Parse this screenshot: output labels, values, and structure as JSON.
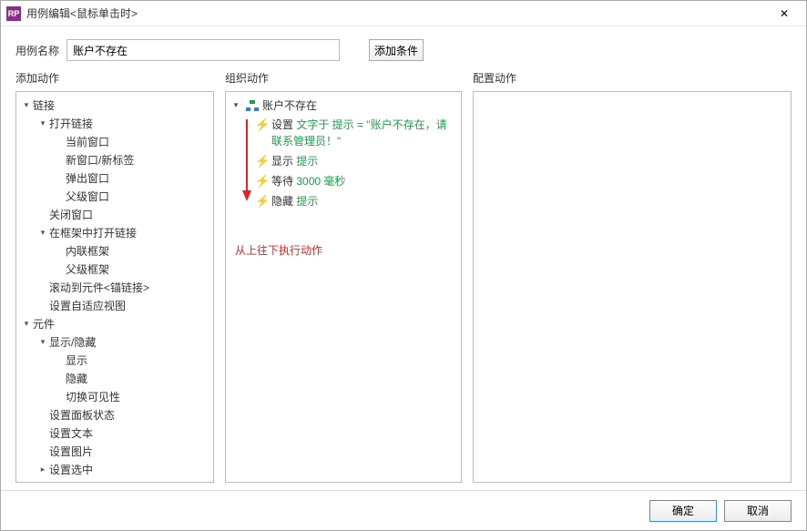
{
  "window": {
    "app_icon_text": "RP",
    "title": "用例编辑<鼠标单击时>"
  },
  "name_row": {
    "label": "用例名称",
    "value": "账户不存在",
    "add_condition": "添加条件"
  },
  "columns": {
    "left_header": "添加动作",
    "mid_header": "组织动作",
    "right_header": "配置动作"
  },
  "left_tree": [
    {
      "level": 0,
      "arrow": "down",
      "label": "链接"
    },
    {
      "level": 1,
      "arrow": "down",
      "label": "打开链接"
    },
    {
      "level": 2,
      "arrow": "none",
      "label": "当前窗口"
    },
    {
      "level": 2,
      "arrow": "none",
      "label": "新窗口/新标签"
    },
    {
      "level": 2,
      "arrow": "none",
      "label": "弹出窗口"
    },
    {
      "level": 2,
      "arrow": "none",
      "label": "父级窗口"
    },
    {
      "level": 1,
      "arrow": "none",
      "label": "关闭窗口"
    },
    {
      "level": 1,
      "arrow": "down",
      "label": "在框架中打开链接"
    },
    {
      "level": 2,
      "arrow": "none",
      "label": "内联框架"
    },
    {
      "level": 2,
      "arrow": "none",
      "label": "父级框架"
    },
    {
      "level": 1,
      "arrow": "none",
      "label": "滚动到元件<锚链接>"
    },
    {
      "level": 1,
      "arrow": "none",
      "label": "设置自适应视图"
    },
    {
      "level": 0,
      "arrow": "down",
      "label": "元件"
    },
    {
      "level": 1,
      "arrow": "down",
      "label": "显示/隐藏"
    },
    {
      "level": 2,
      "arrow": "none",
      "label": "显示"
    },
    {
      "level": 2,
      "arrow": "none",
      "label": "隐藏"
    },
    {
      "level": 2,
      "arrow": "none",
      "label": "切换可见性"
    },
    {
      "level": 1,
      "arrow": "none",
      "label": "设置面板状态"
    },
    {
      "level": 1,
      "arrow": "none",
      "label": "设置文本"
    },
    {
      "level": 1,
      "arrow": "none",
      "label": "设置图片"
    },
    {
      "level": 1,
      "arrow": "right",
      "label": "设置选中"
    }
  ],
  "organize": {
    "case_name": "账户不存在",
    "action1": {
      "prefix": "设置 ",
      "g1": "文字于 提示 = \"账户不存在，请联系管理员！\""
    },
    "action2": {
      "prefix": "显示 ",
      "g1": "提示"
    },
    "action3": {
      "prefix": "等待 ",
      "g1": "3000 毫秒"
    },
    "action4": {
      "prefix": "隐藏 ",
      "g1": "提示"
    },
    "annotation": "从上往下执行动作"
  },
  "footer": {
    "ok": "确定",
    "cancel": "取消"
  }
}
